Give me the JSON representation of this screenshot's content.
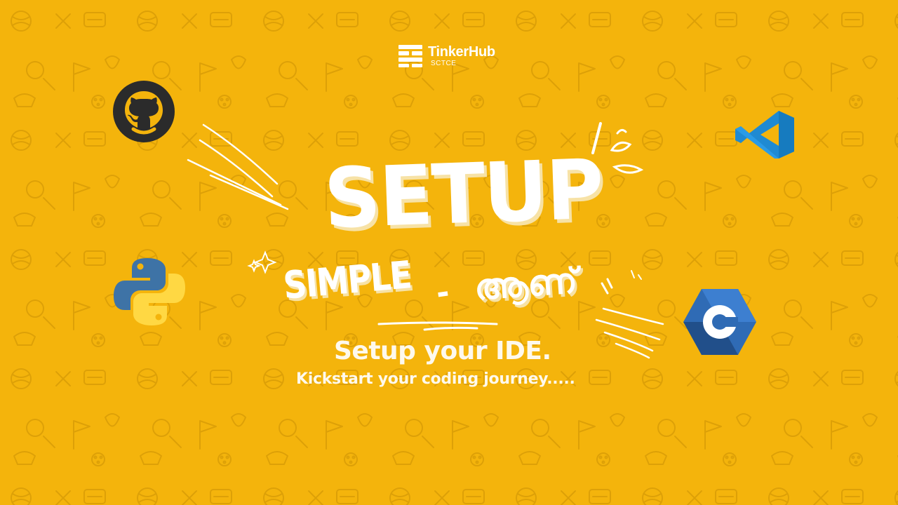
{
  "brand": {
    "name": "TinkerHub",
    "subtitle": "SCTCE"
  },
  "hero": {
    "headline": "SETUP",
    "tagline_left": "SIMPLE",
    "tagline_dash": "-",
    "tagline_right": "ആണ്",
    "subheading": "Setup your IDE.",
    "subtext": "Kickstart your coding journey....."
  },
  "icons": [
    "github-icon",
    "vscode-icon",
    "python-icon",
    "codeblocks-icon"
  ],
  "colors": {
    "background": "#f4b40c",
    "text": "#ffffff",
    "github": "#2b2b2b",
    "python_blue": "#3e73a6",
    "python_yellow": "#ffd843",
    "vscode_blue": "#1f8ad2",
    "codeblocks_blue": "#2f6bb5"
  }
}
